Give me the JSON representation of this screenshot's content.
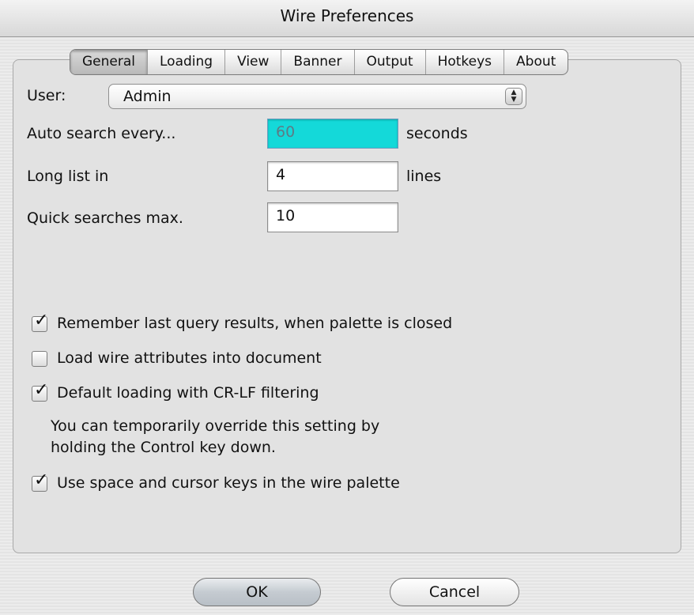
{
  "window": {
    "title": "Wire Preferences"
  },
  "tabs": [
    {
      "label": "General",
      "selected": true
    },
    {
      "label": "Loading",
      "selected": false
    },
    {
      "label": "View",
      "selected": false
    },
    {
      "label": "Banner",
      "selected": false
    },
    {
      "label": "Output",
      "selected": false
    },
    {
      "label": "Hotkeys",
      "selected": false
    },
    {
      "label": "About",
      "selected": false
    }
  ],
  "general": {
    "user_label": "User:",
    "user_value": "Admin",
    "auto_search_label": "Auto search every...",
    "auto_search_value": "60",
    "auto_search_unit": "seconds",
    "long_list_label": "Long list in",
    "long_list_value": "4",
    "long_list_unit": "lines",
    "quick_searches_label": "Quick searches max.",
    "quick_searches_value": "10",
    "remember_results_label": "Remember last query results, when palette is closed",
    "remember_results_checked": true,
    "load_attributes_label": "Load wire attributes into document",
    "load_attributes_checked": false,
    "crlf_filtering_label": "Default loading with CR-LF filtering",
    "crlf_filtering_checked": true,
    "crlf_note_line1": "You can temporarily override this setting by",
    "crlf_note_line2": "holding the Control key down.",
    "cursor_keys_label": "Use space and cursor keys in the wire palette",
    "cursor_keys_checked": true
  },
  "buttons": {
    "ok_label": "OK",
    "cancel_label": "Cancel"
  },
  "icons": {
    "stepper": "updown-arrows-icon",
    "check": "checkmark-icon"
  },
  "colors": {
    "focus_field": "#14d9d9"
  }
}
